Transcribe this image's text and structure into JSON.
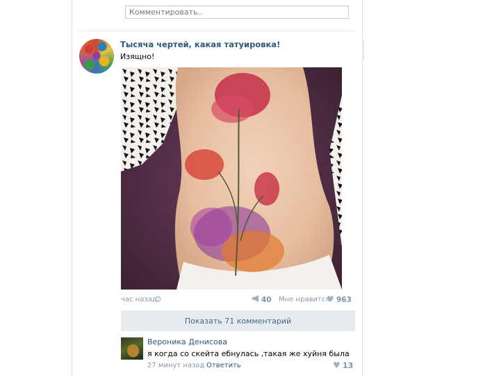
{
  "comment_input": {
    "placeholder": "Комментировать.."
  },
  "post": {
    "title": "Тысяча чертей, какая татуировка!",
    "text": "Изящно!",
    "time": "час назад",
    "shares": "40",
    "like_label": "Мне нравится",
    "likes": "963",
    "show_comments": "Показать 71 комментарий"
  },
  "comment": {
    "author": "Вероника Денисова",
    "text": "я когда со скейта ебнулась ,такая же хуйня была",
    "time": "27 минут назад",
    "separator": "|",
    "reply": "Ответить",
    "likes": "13"
  },
  "icons": {
    "settings": "gear-icon",
    "share": "megaphone-icon",
    "like": "heart-icon"
  },
  "colors": {
    "link": "#2b587a",
    "meta": "#8a97a5",
    "button_bg": "#e7ebef",
    "button_text": "#45688e"
  }
}
